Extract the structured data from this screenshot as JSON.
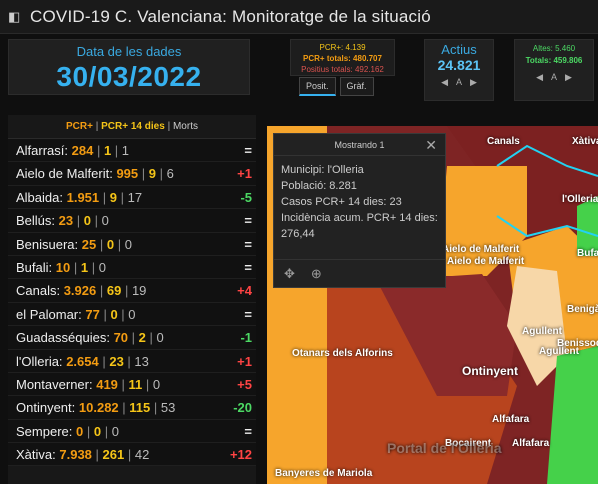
{
  "window_title": "COVID-19 C. Valenciana: Monitoratge de la situació",
  "date_panel": {
    "label": "Data de les dades",
    "value": "30/03/2022"
  },
  "pcr_panel": {
    "pcr": "PCR+: 4.139",
    "pcr_total": "PCR+ totals: 480.707",
    "positius_total": "Positius totals: 492.162"
  },
  "tabs": [
    "Posit.",
    "Gràf."
  ],
  "actius": {
    "label": "Actius",
    "value": "24.821",
    "nav": "A"
  },
  "altes": {
    "altes": "Altes: 5.460",
    "totals": "Totals: 459.806",
    "nav": "A"
  },
  "list_header": {
    "pcr": "PCR+",
    "pcr14": "PCR+ 14 dies",
    "morts": "Morts"
  },
  "rows": [
    {
      "name": "Alfarrasí:",
      "pcr": "284",
      "pcr14": "1",
      "morts": "1",
      "delta": "="
    },
    {
      "name": "Aielo de Malferit:",
      "pcr": "995",
      "pcr14": "9",
      "morts": "6",
      "delta": "+1"
    },
    {
      "name": "Albaida:",
      "pcr": "1.951",
      "pcr14": "9",
      "morts": "17",
      "delta": "-5"
    },
    {
      "name": "Bellús:",
      "pcr": "23",
      "pcr14": "0",
      "morts": "0",
      "delta": "="
    },
    {
      "name": "Benisuera:",
      "pcr": "25",
      "pcr14": "0",
      "morts": "0",
      "delta": "="
    },
    {
      "name": "Bufali:",
      "pcr": "10",
      "pcr14": "1",
      "morts": "0",
      "delta": "="
    },
    {
      "name": "Canals:",
      "pcr": "3.926",
      "pcr14": "69",
      "morts": "19",
      "delta": "+4"
    },
    {
      "name": "el Palomar:",
      "pcr": "77",
      "pcr14": "0",
      "morts": "0",
      "delta": "="
    },
    {
      "name": "Guadasséquies:",
      "pcr": "70",
      "pcr14": "2",
      "morts": "0",
      "delta": "-1"
    },
    {
      "name": "l'Olleria:",
      "pcr": "2.654",
      "pcr14": "23",
      "morts": "13",
      "delta": "+1"
    },
    {
      "name": "Montaverner:",
      "pcr": "419",
      "pcr14": "11",
      "morts": "0",
      "delta": "+5"
    },
    {
      "name": "Ontinyent:",
      "pcr": "10.282",
      "pcr14": "115",
      "morts": "53",
      "delta": "-20"
    },
    {
      "name": "Sempere:",
      "pcr": "0",
      "pcr14": "0",
      "morts": "0",
      "delta": "="
    },
    {
      "name": "Xàtiva:",
      "pcr": "7.938",
      "pcr14": "261",
      "morts": "42",
      "delta": "+12"
    }
  ],
  "popup": {
    "title": "Mostrando 1",
    "lines": [
      "Municipi: l'Olleria",
      "Població: 8.281",
      "Casos PCR+ 14 dies: 23",
      "Incidència acum. PCR+ 14 dies: 276,44"
    ]
  },
  "map_labels": [
    "Canals",
    "Xàtiva",
    "l'Olleria",
    "Aielo de Malferit",
    "Aielo de Malferit",
    "Bufali",
    "Benigànim",
    "Agullent",
    "Agullent",
    "Benissoda",
    "Ontinyent",
    "Otanars dels Alforins",
    "Alfafara",
    "Alfafara",
    "Bocairent",
    "Banyeres de Mariola",
    "Portal de l'Olleria"
  ],
  "colors": {
    "accent": "#36b1ef",
    "pcr14": "#f5c518",
    "pcr": "#f39c12",
    "plus": "#ff4444",
    "minus": "#4cd964"
  }
}
